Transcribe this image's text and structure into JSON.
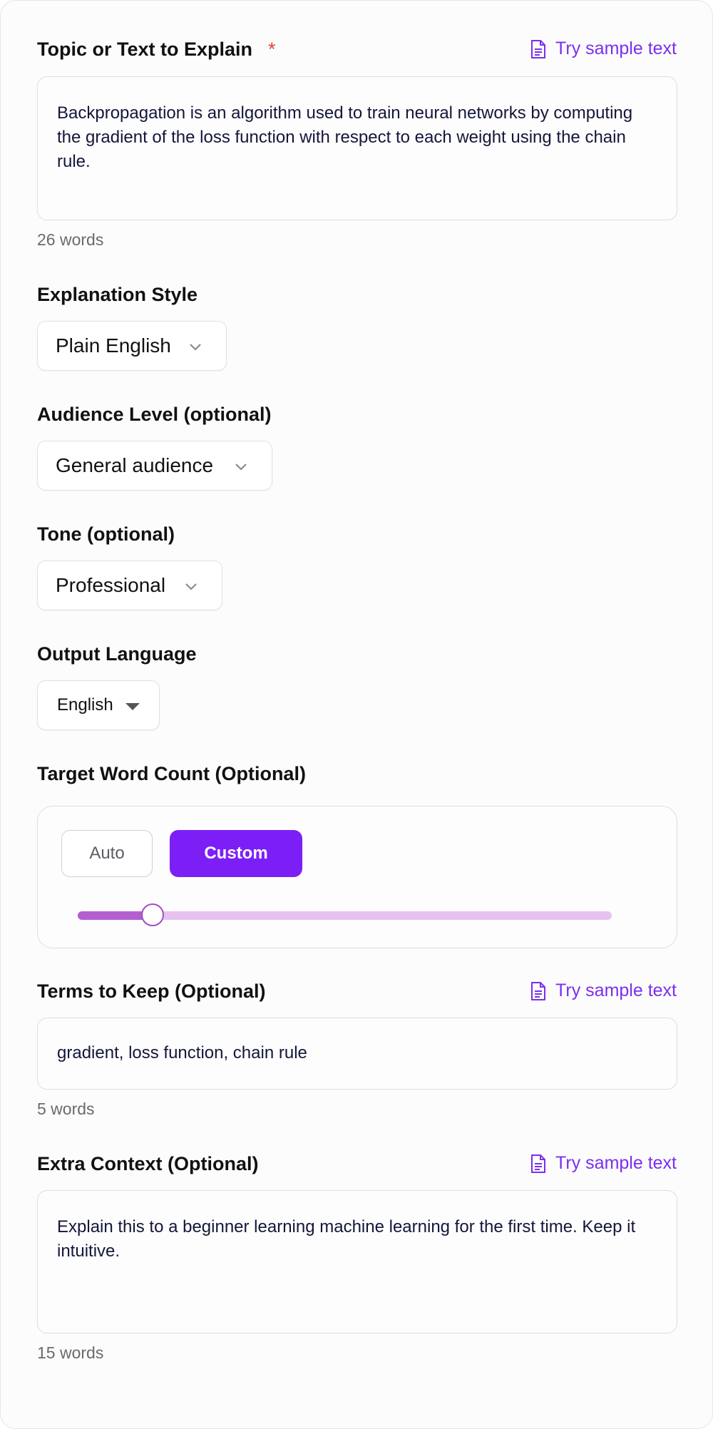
{
  "topic": {
    "label": "Topic or Text to Explain",
    "required_mark": "*",
    "sample_label": "Try sample text",
    "value": "Backpropagation is an algorithm used to train neural networks by computing the gradient of the loss function with respect to each weight using the chain rule.",
    "word_count": "26 words"
  },
  "style": {
    "label": "Explanation Style",
    "selected": "Plain English"
  },
  "audience": {
    "label": "Audience Level (optional)",
    "selected": "General audience"
  },
  "tone": {
    "label": "Tone (optional)",
    "selected": "Professional"
  },
  "language": {
    "label": "Output Language",
    "selected": "English"
  },
  "word_target": {
    "label": "Target Word Count (Optional)",
    "auto_label": "Auto",
    "custom_label": "Custom",
    "slider_fraction": 0.14
  },
  "terms": {
    "label": "Terms to Keep (Optional)",
    "sample_label": "Try sample text",
    "value": "gradient, loss function, chain rule",
    "word_count": "5 words"
  },
  "context": {
    "label": "Extra Context (Optional)",
    "sample_label": "Try sample text",
    "value": "Explain this to a beginner learning machine learning for the first time. Keep it intuitive.",
    "word_count": "15 words"
  },
  "colors": {
    "accent": "#7c1ff7",
    "link": "#7a2ff0",
    "required": "#e0433f",
    "slider_fill": "#b45fd0",
    "slider_track": "#e6c2f0"
  },
  "icons": {
    "sample": "document-icon",
    "select": "chevron-down-icon",
    "language": "caret-down-icon"
  }
}
